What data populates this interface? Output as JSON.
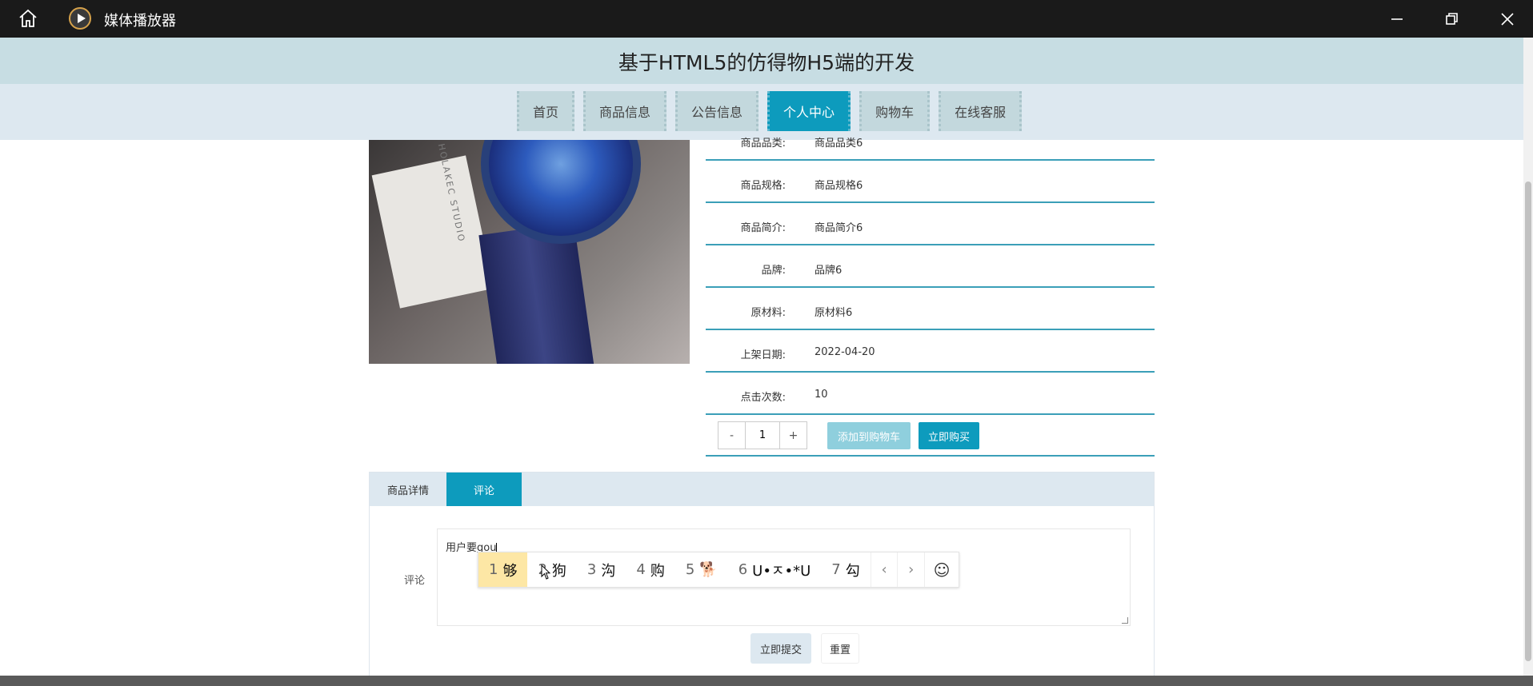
{
  "window": {
    "title": "媒体播放器"
  },
  "site": {
    "title": "基于HTML5的仿得物H5端的开发"
  },
  "nav": {
    "items": [
      "首页",
      "商品信息",
      "公告信息",
      "个人中心",
      "购物车",
      "在线客服"
    ],
    "active_index": 3
  },
  "product": {
    "image_card_text": "HOLAKEC STUDIO",
    "info_rows": [
      {
        "label": "商品品类:",
        "value": "商品品类6"
      },
      {
        "label": "商品规格:",
        "value": "商品规格6"
      },
      {
        "label": "商品简介:",
        "value": "商品简介6"
      },
      {
        "label": "品牌:",
        "value": "品牌6"
      },
      {
        "label": "原材料:",
        "value": "原材料6"
      },
      {
        "label": "上架日期:",
        "value": "2022-04-20"
      },
      {
        "label": "点击次数:",
        "value": "10"
      }
    ],
    "stepper": {
      "minus": "-",
      "quantity": "1",
      "plus": "+"
    },
    "add_to_cart": "添加到购物车",
    "buy_now": "立即购买"
  },
  "tabs": {
    "items": [
      "商品详情",
      "评论"
    ],
    "active_index": 1
  },
  "comment": {
    "label": "评论",
    "text_committed": "用户要",
    "text_composing": "gou",
    "submit": "立即提交",
    "reset": "重置"
  },
  "ime": {
    "candidates": [
      {
        "num": "1",
        "text": "够"
      },
      {
        "num": "2",
        "text": "狗"
      },
      {
        "num": "3",
        "text": "沟"
      },
      {
        "num": "4",
        "text": "购"
      },
      {
        "num": "5",
        "text": "🐕"
      },
      {
        "num": "6",
        "text": "U•ㅈ•*U"
      },
      {
        "num": "7",
        "text": "勾"
      }
    ],
    "selected_index": 0,
    "prev": "‹",
    "next": "›",
    "emoji": "☺"
  }
}
